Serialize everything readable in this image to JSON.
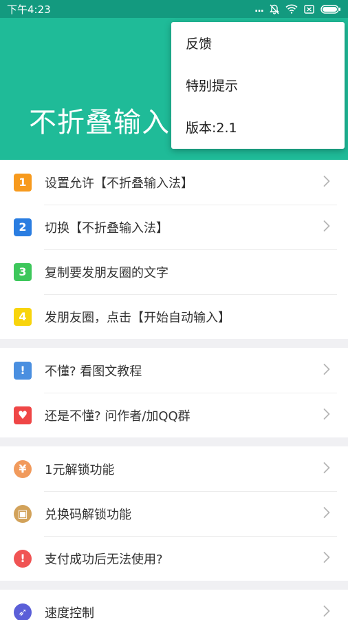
{
  "status_bar": {
    "time": "下午4:23",
    "dots": "...",
    "bg": "#139a7f"
  },
  "header": {
    "title": "不折叠输入法",
    "bg": "#1fbb98"
  },
  "menu": {
    "items": [
      {
        "label": "反馈"
      },
      {
        "label": "特别提示"
      },
      {
        "label": "版本:2.1"
      }
    ]
  },
  "groups": [
    {
      "rows": [
        {
          "label": "设置允许【不折叠输入法】",
          "icon": "digit-1-icon",
          "icon_text": "1",
          "icon_color": "#f79a1d",
          "chevron": true
        },
        {
          "label": "切换【不折叠输入法】",
          "icon": "digit-2-icon",
          "icon_text": "2",
          "icon_color": "#2a7de1",
          "chevron": true
        },
        {
          "label": "复制要发朋友圈的文字",
          "icon": "digit-3-icon",
          "icon_text": "3",
          "icon_color": "#3dc75b",
          "chevron": false
        },
        {
          "label": "发朋友圈，点击【开始自动输入】",
          "icon": "digit-4-icon",
          "icon_text": "4",
          "icon_color": "#f8d40c",
          "chevron": false
        }
      ]
    },
    {
      "rows": [
        {
          "label": "不懂? 看图文教程",
          "icon": "exclamation-icon",
          "icon_text": "!",
          "icon_color": "#4a8fe0",
          "chevron": true
        },
        {
          "label": "还是不懂? 问作者/加QQ群",
          "icon": "heart-icon",
          "icon_text": "♥",
          "icon_color": "#ef4646",
          "chevron": true
        }
      ]
    },
    {
      "rows": [
        {
          "label": "1元解锁功能",
          "icon": "yen-icon",
          "icon_text": "¥",
          "icon_color": "#f19a5c",
          "chevron": true
        },
        {
          "label": "兑换码解锁功能",
          "icon": "gift-icon",
          "icon_text": "▣",
          "icon_color": "#d2a25a",
          "chevron": true
        },
        {
          "label": "支付成功后无法使用?",
          "icon": "alert-icon",
          "icon_text": "!",
          "icon_color": "#f05454",
          "chevron": true
        }
      ]
    },
    {
      "rows": [
        {
          "label": "速度控制",
          "icon": "rocket-icon",
          "icon_text": "➶",
          "icon_color": "#5b5fd8",
          "chevron": true
        }
      ]
    }
  ]
}
